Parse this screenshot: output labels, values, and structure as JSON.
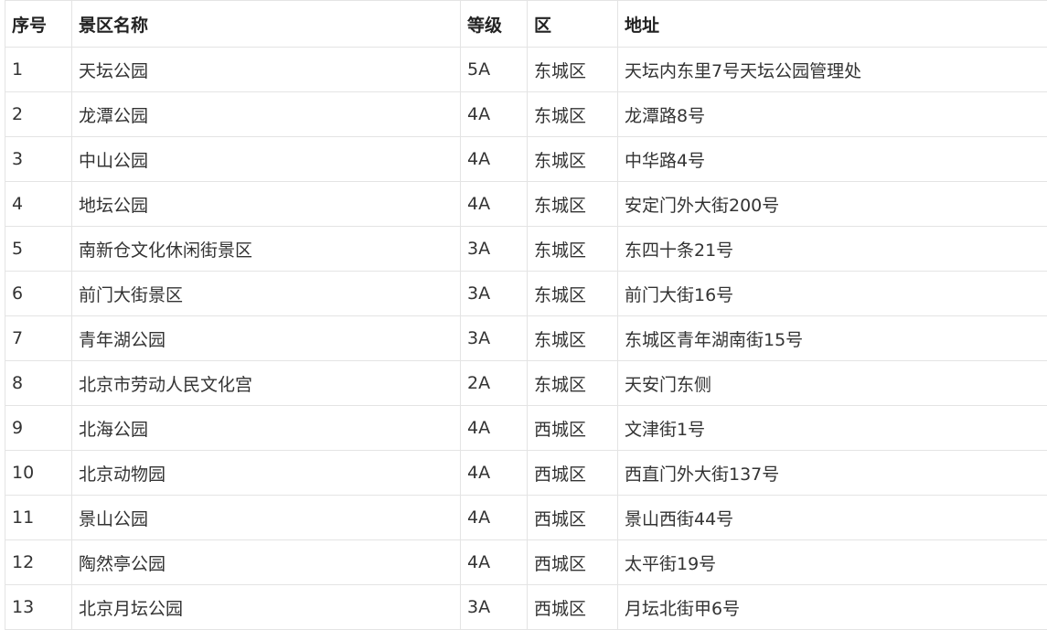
{
  "table": {
    "headers": [
      "序号",
      "景区名称",
      "等级",
      "区",
      "地址"
    ],
    "rows": [
      [
        "1",
        "天坛公园",
        "5A",
        "东城区",
        "天坛内东里7号天坛公园管理处"
      ],
      [
        "2",
        "龙潭公园",
        "4A",
        "东城区",
        "龙潭路8号"
      ],
      [
        "3",
        "中山公园",
        "4A",
        "东城区",
        "中华路4号"
      ],
      [
        "4",
        "地坛公园",
        "4A",
        "东城区",
        "安定门外大街200号"
      ],
      [
        "5",
        "南新仓文化休闲街景区",
        "3A",
        "东城区",
        "东四十条21号"
      ],
      [
        "6",
        "前门大街景区",
        "3A",
        "东城区",
        "前门大街16号"
      ],
      [
        "7",
        "青年湖公园",
        "3A",
        "东城区",
        "东城区青年湖南街15号"
      ],
      [
        "8",
        "北京市劳动人民文化宫",
        "2A",
        "东城区",
        "天安门东侧"
      ],
      [
        "9",
        "北海公园",
        "4A",
        "西城区",
        "文津街1号"
      ],
      [
        "10",
        "北京动物园",
        "4A",
        "西城区",
        "西直门外大街137号"
      ],
      [
        "11",
        "景山公园",
        "4A",
        "西城区",
        "景山西街44号"
      ],
      [
        "12",
        "陶然亭公园",
        "4A",
        "西城区",
        "太平街19号"
      ],
      [
        "13",
        "北京月坛公园",
        "3A",
        "西城区",
        "月坛北街甲6号"
      ]
    ]
  }
}
